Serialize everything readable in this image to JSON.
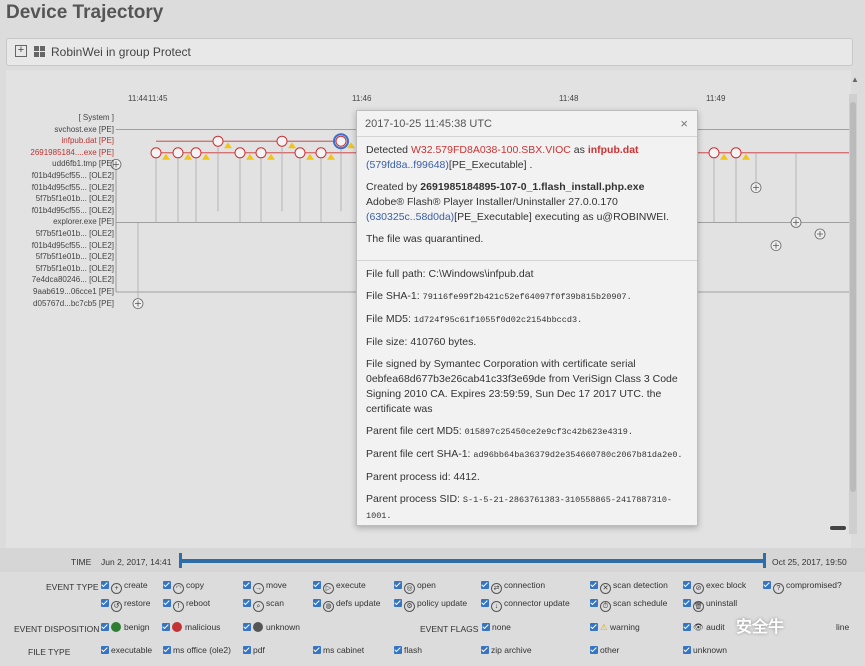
{
  "page": {
    "title": "Device Trajectory"
  },
  "group_bar": {
    "label": "RobinWei in group Protect"
  },
  "timeline": {
    "ticks": [
      "11:44",
      "11:45",
      "11:46",
      "11:48",
      "11:49"
    ],
    "processes": [
      {
        "label": "[ System ]",
        "red": false
      },
      {
        "label": "svchost.exe [PE]",
        "red": false
      },
      {
        "label": "infpub.dat [PE]",
        "red": true
      },
      {
        "label": "2691985184....exe [PE]",
        "red": true
      },
      {
        "label": "udd6fb1.tmp [PE]",
        "red": false
      },
      {
        "label": "f01b4d95cf55... [OLE2]",
        "red": false
      },
      {
        "label": "f01b4d95cf55... [OLE2]",
        "red": false
      },
      {
        "label": "5f7b5f1e01b... [OLE2]",
        "red": false
      },
      {
        "label": "f01b4d95cf55... [OLE2]",
        "red": false
      },
      {
        "label": "explorer.exe [PE]",
        "red": false
      },
      {
        "label": "5f7b5f1e01b... [OLE2]",
        "red": false
      },
      {
        "label": "f01b4d95cf55... [OLE2]",
        "red": false
      },
      {
        "label": "5f7b5f1e01b... [OLE2]",
        "red": false
      },
      {
        "label": "5f7b5f1e01b... [OLE2]",
        "red": false
      },
      {
        "label": "7e4dca80246... [OLE2]",
        "red": false
      },
      {
        "label": "9aab619...06cce1 [PE]",
        "red": false
      },
      {
        "label": "d05767d...bc7cb5 [PE]",
        "red": false
      }
    ]
  },
  "popup": {
    "timestamp": "2017-10-25 11:45:38 UTC",
    "detected_prefix": "Detected",
    "detection_name": "W32.579FD8A038-100.SBX.VIOC",
    "as_word": "as",
    "detected_file": "infpub.dat",
    "detected_hash": "(579fd8a..f99648)",
    "detected_type": "[PE_Executable] .",
    "created_by_prefix": "Created by",
    "creator_file": "2691985184895-107-0_1.flash_install.php.exe",
    "creator_desc": "Adobe® Flash® Player Installer/Uninstaller 27.0.0.170",
    "creator_hash": "(630325c..58d0da)",
    "creator_exec": "[PE_Executable] executing as u@ROBINWEI.",
    "quarantined": "The file was quarantined.",
    "full_path": "File full path: C:\\Windows\\infpub.dat",
    "sha1_label": "File SHA-1:",
    "sha1": "79116fe99f2b421c52ef64097f0f39b815b20907.",
    "md5_label": "File MD5:",
    "md5": "1d724f95c61f1055f0d02c2154bbccd3.",
    "size": "File size: 410760 bytes.",
    "signed": "File signed by Symantec Corporation with certificate serial 0ebfea68d677b3e26cab41c33f3e69de from VeriSign Class 3 Code Signing 2010 CA. Expires 23:59:59, Sun Dec 17 2017 UTC. the certificate was",
    "parent_md5_label": "Parent file cert MD5:",
    "parent_md5": "015897c25450ce2e9cf3c42b623e4319.",
    "parent_sha1_label": "Parent file cert SHA-1:",
    "parent_sha1": "ad96bb64ba36379d2e354660780c2067b81da2e0.",
    "parent_pid": "Parent process id: 4412.",
    "parent_sid_label": "Parent process SID:",
    "parent_sid": "S-1-5-21-2863761383-310558865-2417887310-1001."
  },
  "time_range": {
    "label": "TIME",
    "start": "Jun 2, 2017, 14:41",
    "end": "Oct 25, 2017, 19:50"
  },
  "event_type": {
    "label": "EVENT TYPE",
    "row1": [
      "create",
      "copy",
      "move",
      "execute",
      "open",
      "connection",
      "scan detection",
      "exec block",
      "compromised?"
    ],
    "row2": [
      "restore",
      "reboot",
      "scan",
      "defs update",
      "policy update",
      "connector update",
      "scan schedule",
      "uninstall"
    ]
  },
  "event_disposition": {
    "label": "EVENT DISPOSITION",
    "items": [
      "benign",
      "malicious",
      "unknown"
    ]
  },
  "event_flags": {
    "label": "EVENT FLAGS",
    "items": [
      "none",
      "warning",
      "audit"
    ],
    "extra": "line"
  },
  "file_type": {
    "label": "FILE TYPE",
    "items": [
      "executable",
      "ms office (ole2)",
      "pdf",
      "ms cabinet",
      "flash",
      "zip archive",
      "other",
      "unknown"
    ]
  },
  "watermark": "安全牛",
  "colors": {
    "accent": "#3575c4",
    "malicious": "#c33333",
    "benign": "#2e7d32",
    "track": "#2f6da8"
  }
}
